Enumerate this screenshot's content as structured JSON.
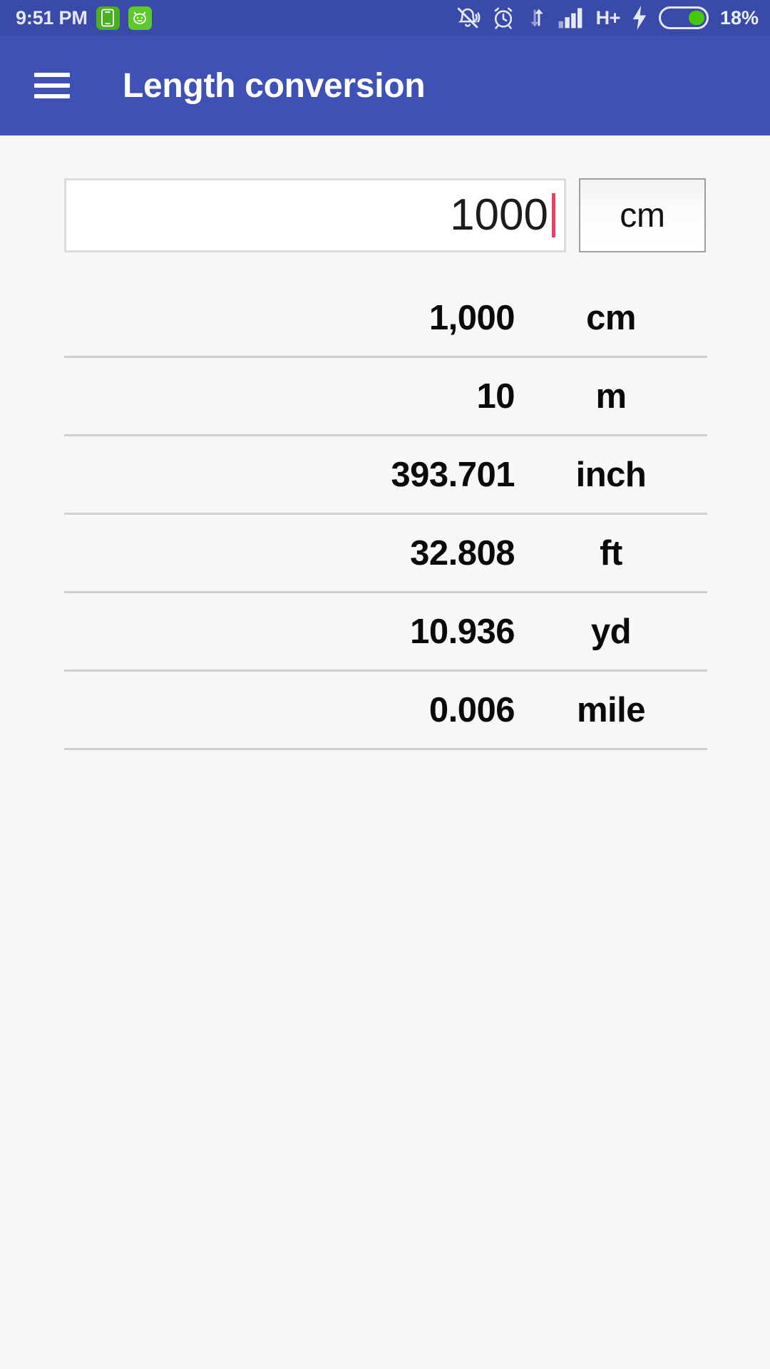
{
  "status_bar": {
    "clock": "9:51 PM",
    "icons_left": [
      "phone-app-icon",
      "android-app-icon"
    ],
    "icons_right": [
      "notifications-off-icon",
      "alarm-icon",
      "sync-icon",
      "signal-bars-icon"
    ],
    "network_type": "H+",
    "charging_icon": "bolt-icon",
    "battery_percent": "18%",
    "battery_level": 18,
    "background_color": "#3a4aa8",
    "text_color": "#e6e8f5",
    "app_icon_color": "#4caf23",
    "battery_fill_color": "#43c908"
  },
  "app_bar": {
    "menu_icon": "hamburger-menu-icon",
    "title": "Length conversion",
    "background_color": "#3f51b5",
    "title_color": "#ffffff"
  },
  "input": {
    "value": "1000",
    "placeholder": "",
    "caret_color": "#ef3a6d",
    "unit": "cm",
    "unit_spinner_icon": "dropdown-spinner"
  },
  "results": {
    "rows": [
      {
        "value": "1,000",
        "unit": "cm"
      },
      {
        "value": "10",
        "unit": "m"
      },
      {
        "value": "393.701",
        "unit": "inch"
      },
      {
        "value": "32.808",
        "unit": "ft"
      },
      {
        "value": "10.936",
        "unit": "yd"
      },
      {
        "value": "0.006",
        "unit": "mile"
      }
    ],
    "divider_color": "#cfcfcf"
  },
  "page": {
    "background_color": "#f7f7f7"
  }
}
